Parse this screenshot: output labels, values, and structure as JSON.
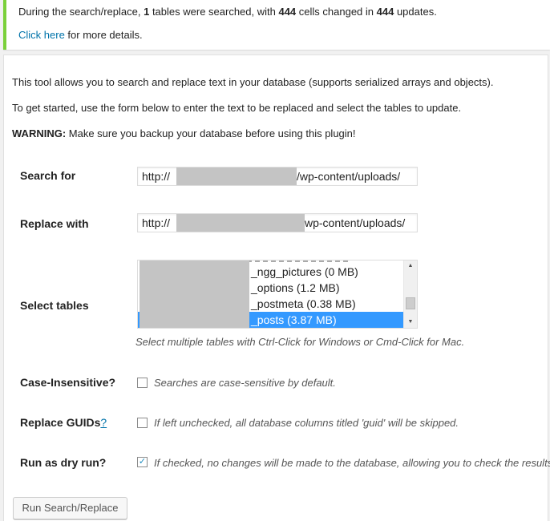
{
  "notice": {
    "prefix": "During the search/replace, ",
    "tables_searched": "1",
    "middle1": " tables were searched, with ",
    "cells_changed": "444",
    "middle2": " cells changed in ",
    "updates": "444",
    "suffix": " updates.",
    "link_text": "Click here",
    "link_suffix": " for more details."
  },
  "intro": {
    "line1": "This tool allows you to search and replace text in your database (supports serialized arrays and objects).",
    "line2": "To get started, use the form below to enter the text to be replaced and select the tables to update.",
    "warning_label": "WARNING:",
    "warning_text": " Make sure you backup your database before using this plugin!"
  },
  "form": {
    "search_for": {
      "label": "Search for",
      "value_prefix": "http://",
      "value_suffix": "/wp-content/uploads/"
    },
    "replace_with": {
      "label": "Replace with",
      "value_prefix": "http://",
      "value_suffix": "wp-content/uploads/"
    },
    "select_tables": {
      "label": "Select tables",
      "options": [
        "_ngg_pictures (0 MB)",
        "_options (1.2 MB)",
        "_postmeta (0.38 MB)",
        "_posts (3.87 MB)"
      ],
      "selected": "_posts (3.87 MB)",
      "hint": "Select multiple tables with Ctrl-Click for Windows or Cmd-Click for Mac."
    },
    "case_insensitive": {
      "label": "Case-Insensitive?",
      "checked": false,
      "hint": "Searches are case-sensitive by default."
    },
    "replace_guids": {
      "label": "Replace GUIDs",
      "help": "?",
      "checked": false,
      "hint": "If left unchecked, all database columns titled 'guid' will be skipped."
    },
    "dry_run": {
      "label": "Run as dry run?",
      "checked": true,
      "hint": "If checked, no changes will be made to the database, allowing you to check the results"
    }
  },
  "submit_label": "Run Search/Replace",
  "colors": {
    "accent": "#0073aa",
    "success": "#7ad03a",
    "selection": "#3399ff"
  }
}
